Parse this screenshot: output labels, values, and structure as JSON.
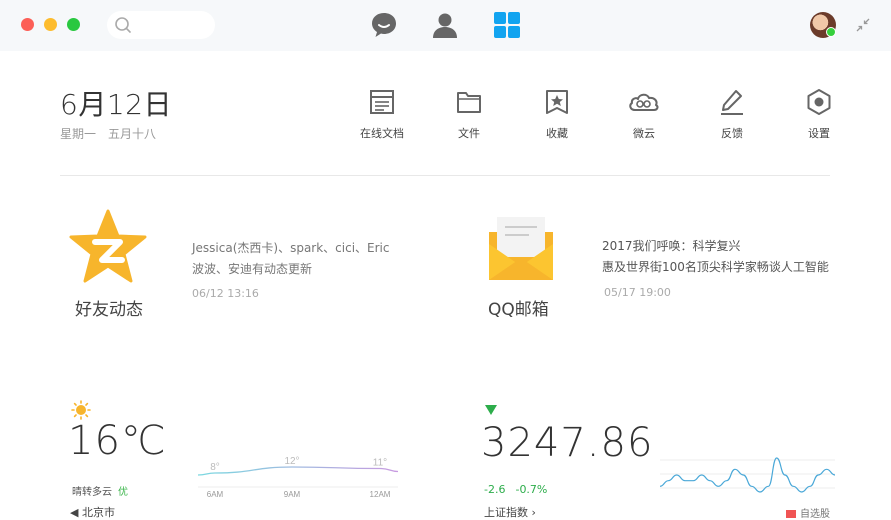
{
  "titlebar": {
    "search_placeholder": "",
    "nav": [
      "chat-icon",
      "contacts-icon",
      "apps-icon"
    ],
    "accent": "#12a4f0"
  },
  "date": {
    "main": "6月12日",
    "lunar": "星期一　五月十八"
  },
  "tools": [
    {
      "label": "在线文档",
      "icon": "document-icon"
    },
    {
      "label": "文件",
      "icon": "folder-icon"
    },
    {
      "label": "收藏",
      "icon": "bookmark-icon"
    },
    {
      "label": "微云",
      "icon": "cloud-icon"
    },
    {
      "label": "反馈",
      "icon": "pencil-icon"
    },
    {
      "label": "设置",
      "icon": "settings-icon"
    }
  ],
  "qzone": {
    "title": "好友动态",
    "line1": "Jessica(杰西卡)、spark、cici、Eric",
    "line2": "波波、安迪有动态更新",
    "time": "06/12 13:16"
  },
  "mail": {
    "title": "QQ邮箱",
    "line1": "2017我们呼唤：科学复兴",
    "line2": "惠及世界街100名顶尖科学家畅谈人工智能",
    "time": "05/17 19:00"
  },
  "weather": {
    "temperature": "16℃",
    "description": "晴转多云",
    "aqi": "优",
    "city": "◀ 北京市",
    "accent": "#f7b52c"
  },
  "stock": {
    "value": "3247.86",
    "change": "-2.6",
    "percent": "-0.7%",
    "name": "上证指数 ›",
    "legend": "自选股",
    "down_color": "#2dad4b"
  },
  "chart_data": [
    {
      "type": "line",
      "title": "",
      "x": [
        "6AM",
        "9AM",
        "12AM"
      ],
      "series": [
        {
          "values": [
            8,
            12,
            11
          ],
          "labels": [
            "8°",
            "12°",
            "11°"
          ]
        }
      ],
      "ylim": [
        0,
        20
      ],
      "grid": false
    },
    {
      "type": "line",
      "title": "",
      "series": [
        {
          "values": [
            3,
            4,
            5,
            4,
            4,
            5,
            4,
            3,
            4,
            6,
            5,
            3,
            2,
            3,
            8,
            5,
            3,
            2,
            3,
            5,
            6,
            5
          ]
        }
      ],
      "grid": true
    }
  ]
}
